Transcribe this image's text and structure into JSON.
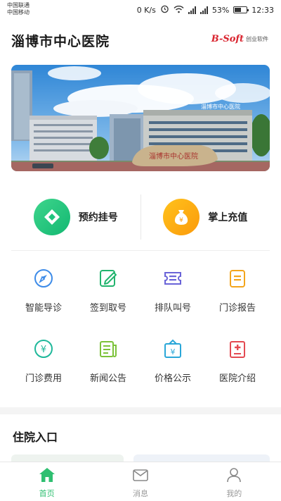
{
  "status_bar": {
    "carrier_1": "中国联通",
    "carrier_2": "中国移动",
    "network_speed": "0 K/s",
    "battery": "53%",
    "time": "12:33"
  },
  "header": {
    "title": "淄博市中心医院",
    "brand_logo": "B-Soft",
    "brand_name": "创业软件"
  },
  "banner": {
    "sign_text": "淄博市中心医院"
  },
  "primary_actions": [
    {
      "label": "预约挂号",
      "icon": "diamond-icon",
      "color": "#1fc47d"
    },
    {
      "label": "掌上充值",
      "icon": "money-bag-icon",
      "color": "#fdaa12"
    }
  ],
  "services": [
    {
      "label": "智能导诊",
      "icon": "compass-icon",
      "color": "#3d8be8"
    },
    {
      "label": "签到取号",
      "icon": "edit-icon",
      "color": "#22b46e"
    },
    {
      "label": "排队叫号",
      "icon": "ticket-icon",
      "color": "#6a64d8"
    },
    {
      "label": "门诊报告",
      "icon": "report-icon",
      "color": "#f3a51c"
    },
    {
      "label": "门诊费用",
      "icon": "fee-icon",
      "color": "#1fb89a"
    },
    {
      "label": "新闻公告",
      "icon": "news-icon",
      "color": "#7cc23a"
    },
    {
      "label": "价格公示",
      "icon": "price-icon",
      "color": "#2aa7d8"
    },
    {
      "label": "医院介绍",
      "icon": "hospital-icon",
      "color": "#e44a52"
    }
  ],
  "section": {
    "title": "住院入口"
  },
  "tabs": [
    {
      "label": "首页",
      "icon": "home-icon",
      "active": true
    },
    {
      "label": "消息",
      "icon": "mail-icon",
      "active": false
    },
    {
      "label": "我的",
      "icon": "user-icon",
      "active": false
    }
  ],
  "colors": {
    "accent": "#2fbf71",
    "inactive": "#999999"
  }
}
